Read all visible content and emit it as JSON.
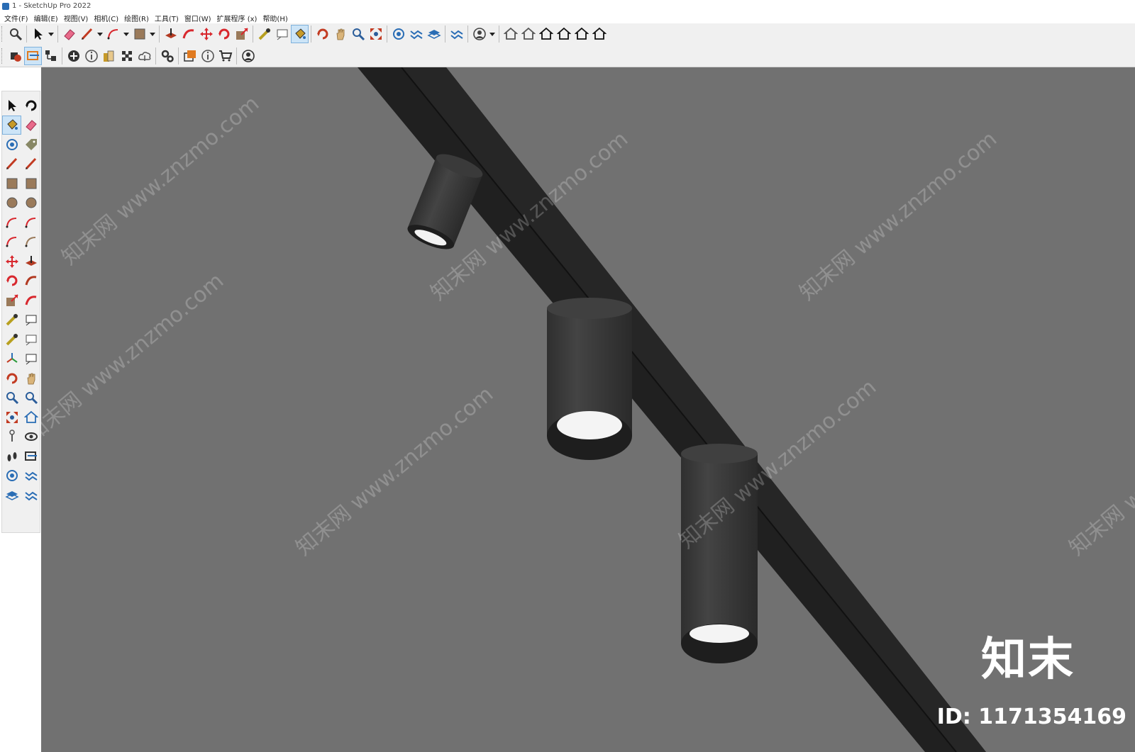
{
  "window": {
    "title": "1 - SketchUp Pro 2022"
  },
  "menu": [
    "文件(F)",
    "编辑(E)",
    "视图(V)",
    "相机(C)",
    "绘图(R)",
    "工具(T)",
    "窗口(W)",
    "扩展程序 (x)",
    "帮助(H)"
  ],
  "toolbar_top": [
    {
      "name": "search-icon",
      "color": "#3a3a3a"
    },
    {
      "sep": true
    },
    {
      "name": "select-arrow-icon",
      "color": "#111111"
    },
    {
      "name": "dropdown-arrow-icon",
      "dd": true
    },
    {
      "sep": true
    },
    {
      "name": "eraser-icon",
      "color": "#e86a8a"
    },
    {
      "name": "pencil-line-icon",
      "color": "#c23b22"
    },
    {
      "name": "dropdown-arrow-icon",
      "dd": true
    },
    {
      "name": "arc-icon",
      "color": "#d8282e"
    },
    {
      "name": "dropdown-arrow-icon",
      "dd": true
    },
    {
      "name": "rectangle-icon",
      "color": "#9a7a5a"
    },
    {
      "name": "dropdown-arrow-icon",
      "dd": true
    },
    {
      "sep": true
    },
    {
      "name": "push-pull-icon",
      "color": "#b23a22"
    },
    {
      "name": "follow-me-icon",
      "color": "#d8282e"
    },
    {
      "name": "move-icon",
      "color": "#d8282e"
    },
    {
      "name": "rotate-icon",
      "color": "#d8282e"
    },
    {
      "name": "scale-icon",
      "color": "#d8282e"
    },
    {
      "sep": true
    },
    {
      "name": "tape-measure-icon",
      "color": "#b8a020"
    },
    {
      "name": "text-label-icon",
      "color": "#555555"
    },
    {
      "name": "paint-bucket-icon",
      "color": "#c79a28",
      "active": true
    },
    {
      "sep": true
    },
    {
      "name": "orbit-icon",
      "color": "#c23b22"
    },
    {
      "name": "pan-hand-icon",
      "color": "#d9b47a"
    },
    {
      "name": "zoom-icon",
      "color": "#2a5d9a"
    },
    {
      "name": "zoom-extents-icon",
      "color": "#c23b22"
    },
    {
      "sep": true
    },
    {
      "name": "components-icon",
      "color": "#2a6db5"
    },
    {
      "name": "sandbox-icon",
      "color": "#2a6db5"
    },
    {
      "name": "layers-icon",
      "color": "#2a6db5"
    },
    {
      "sep": true
    },
    {
      "name": "extension-settings-icon",
      "color": "#2a6db5"
    },
    {
      "sep": true
    },
    {
      "name": "user-account-icon",
      "color": "#444444"
    },
    {
      "name": "dropdown-arrow-icon",
      "dd": true
    },
    {
      "sep": true
    },
    {
      "name": "iso-view-icon",
      "color": "#555555"
    },
    {
      "name": "top-view-icon",
      "color": "#555555"
    },
    {
      "name": "front-view-icon",
      "color": "#111111"
    },
    {
      "name": "right-view-icon",
      "color": "#111111"
    },
    {
      "name": "back-view-icon",
      "color": "#111111"
    },
    {
      "name": "left-view-icon",
      "color": "#111111"
    }
  ],
  "toolbar_second": [
    {
      "name": "solid-tools-icon",
      "color": "#c23b22"
    },
    {
      "name": "section-plane-icon",
      "color": "#e07a20",
      "active": true
    },
    {
      "name": "outliner-icon",
      "color": "#333333"
    },
    {
      "sep": true
    },
    {
      "name": "add-location-icon",
      "color": "#333333"
    },
    {
      "name": "model-info-icon",
      "color": "#555555"
    },
    {
      "name": "materials-icon",
      "color": "#c79a28"
    },
    {
      "name": "styles-icon",
      "color": "#333333"
    },
    {
      "name": "cloud-upload-icon",
      "color": "#555555"
    },
    {
      "sep": true
    },
    {
      "name": "extension-manager-icon",
      "color": "#333333"
    },
    {
      "sep": true
    },
    {
      "name": "scenes-icon",
      "color": "#e07a20"
    },
    {
      "name": "info-icon",
      "color": "#555555"
    },
    {
      "name": "shopping-cart-icon",
      "color": "#333333"
    },
    {
      "sep": true
    },
    {
      "name": "profile-icon",
      "color": "#333333"
    }
  ],
  "left_toolbar": [
    {
      "name": "select-arrow-icon",
      "color": "#111111"
    },
    {
      "name": "orbit-mini-icon",
      "color": "#111111"
    },
    {
      "name": "paint-bucket-icon",
      "color": "#c79a28",
      "active": true
    },
    {
      "name": "eraser-icon",
      "color": "#e86a8a"
    },
    {
      "name": "make-component-icon",
      "color": "#2a6db5"
    },
    {
      "name": "tag-icon",
      "color": "#888866"
    },
    {
      "name": "pencil-line-icon",
      "color": "#c23b22"
    },
    {
      "name": "freehand-icon",
      "color": "#c23b22"
    },
    {
      "name": "rectangle-icon",
      "color": "#9a7a5a"
    },
    {
      "name": "rotated-rectangle-icon",
      "color": "#9a7a5a"
    },
    {
      "name": "circle-icon",
      "color": "#9a7a5a"
    },
    {
      "name": "polygon-icon",
      "color": "#9a7a5a"
    },
    {
      "name": "arc-icon",
      "color": "#d8282e"
    },
    {
      "name": "two-point-arc-icon",
      "color": "#d8282e"
    },
    {
      "name": "three-point-arc-icon",
      "color": "#d8282e"
    },
    {
      "name": "pie-icon",
      "color": "#9a7a5a"
    },
    {
      "name": "move-icon",
      "color": "#d8282e"
    },
    {
      "name": "push-pull-icon",
      "color": "#b23a22"
    },
    {
      "name": "rotate-icon",
      "color": "#d8282e"
    },
    {
      "name": "follow-me-icon",
      "color": "#b23a22"
    },
    {
      "name": "scale-icon",
      "color": "#d8282e"
    },
    {
      "name": "offset-icon",
      "color": "#d8282e"
    },
    {
      "name": "tape-measure-icon",
      "color": "#b8a020"
    },
    {
      "name": "dimension-icon",
      "color": "#333333"
    },
    {
      "name": "protractor-icon",
      "color": "#b8a020"
    },
    {
      "name": "text-label-icon",
      "color": "#555555"
    },
    {
      "name": "axes-icon",
      "color": "#2a6db5"
    },
    {
      "name": "3d-text-icon",
      "color": "#333333"
    },
    {
      "name": "orbit-icon",
      "color": "#c23b22"
    },
    {
      "name": "pan-hand-icon",
      "color": "#d9b47a"
    },
    {
      "name": "zoom-icon",
      "color": "#2a5d9a"
    },
    {
      "name": "zoom-window-icon",
      "color": "#2a5d9a"
    },
    {
      "name": "zoom-extents-icon",
      "color": "#c23b22"
    },
    {
      "name": "previous-view-icon",
      "color": "#2a6db5"
    },
    {
      "name": "position-camera-icon",
      "color": "#555555"
    },
    {
      "name": "look-around-icon",
      "color": "#333333"
    },
    {
      "name": "walk-icon",
      "color": "#333333"
    },
    {
      "name": "section-plane-icon",
      "color": "#333333"
    },
    {
      "name": "components-icon",
      "color": "#2a6db5"
    },
    {
      "name": "sandbox-icon",
      "color": "#2a6db5"
    },
    {
      "name": "layers-icon",
      "color": "#2a6db5"
    },
    {
      "name": "extension-settings-icon",
      "color": "#2a6db5"
    }
  ],
  "watermark": {
    "text": "知末网 www.znzmo.com",
    "brand": "知末",
    "id_label": "ID: 1171354169",
    "color": "#ffffff"
  },
  "scene_colors": {
    "background": "#717171",
    "track": "#202020",
    "lamp_body": "#3b3b3b",
    "lens": "#f4f4f4"
  }
}
